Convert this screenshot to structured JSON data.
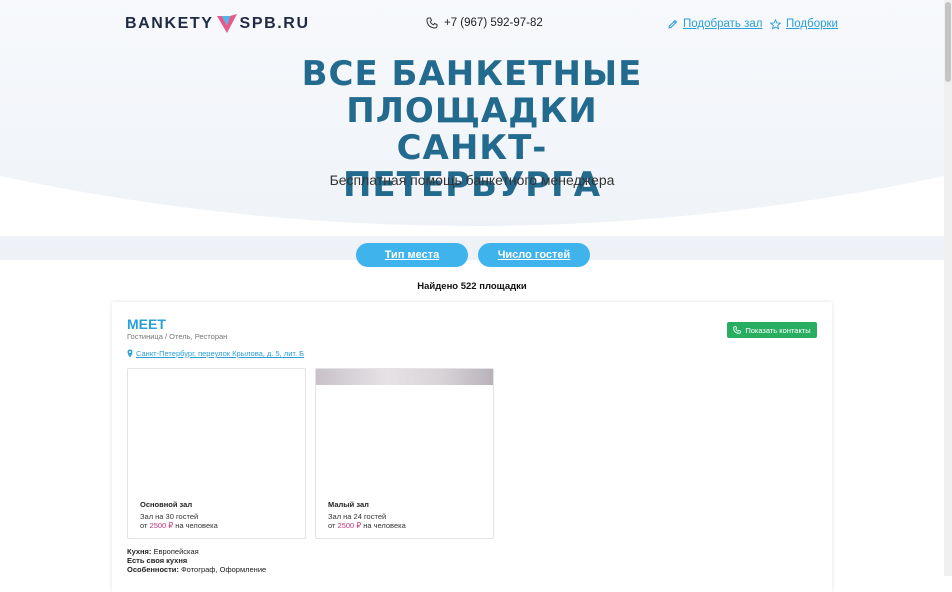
{
  "header": {
    "logo_text_left": "BANKETY",
    "logo_text_right": "SPB.RU",
    "phone": "+7 (967) 592-97-82",
    "nav": [
      {
        "label": "Подобрать зал",
        "icon": "pencil-icon"
      },
      {
        "label": "Подборки",
        "icon": "star-icon"
      }
    ]
  },
  "hero": {
    "title_lines": [
      "ВСЕ БАНКЕТНЫЕ",
      "ПЛОЩАДКИ САНКТ-",
      "ПЕТЕРБУРГА"
    ],
    "subtitle": "Бесплатная помощь банкетного менеджера"
  },
  "filters": {
    "buttons": [
      "Тип места",
      "Число гостей"
    ]
  },
  "results": {
    "found_text": "Найдено 522 площадки"
  },
  "venue": {
    "name": "MEET",
    "type": "Гостиница / Отель, Ресторан",
    "address": "Санкт-Петербург, переулок Крылова, д. 5, лит. Б",
    "contacts_label": "Показать контакты",
    "halls": [
      {
        "name": "Основной зал",
        "capacity": "Зал на 30 гостей",
        "price_prefix": "от",
        "price": "2500 ₽",
        "price_suffix": "на человека"
      },
      {
        "name": "Малый зал",
        "capacity": "Зал на 24 гостей",
        "price_prefix": "от",
        "price": "2500 ₽",
        "price_suffix": "на человека"
      }
    ],
    "features": [
      {
        "label": "Кухня:",
        "value": "Европейская"
      },
      {
        "label": "Есть своя кухня",
        "value": ""
      },
      {
        "label": "Особенности:",
        "value": "Фотограф, Оформление"
      }
    ]
  },
  "colors": {
    "accent": "#2a9fd8",
    "button": "#3fb3ec",
    "title": "#236a8f",
    "contacts_button": "#27ae60",
    "price": "#c2347a"
  }
}
